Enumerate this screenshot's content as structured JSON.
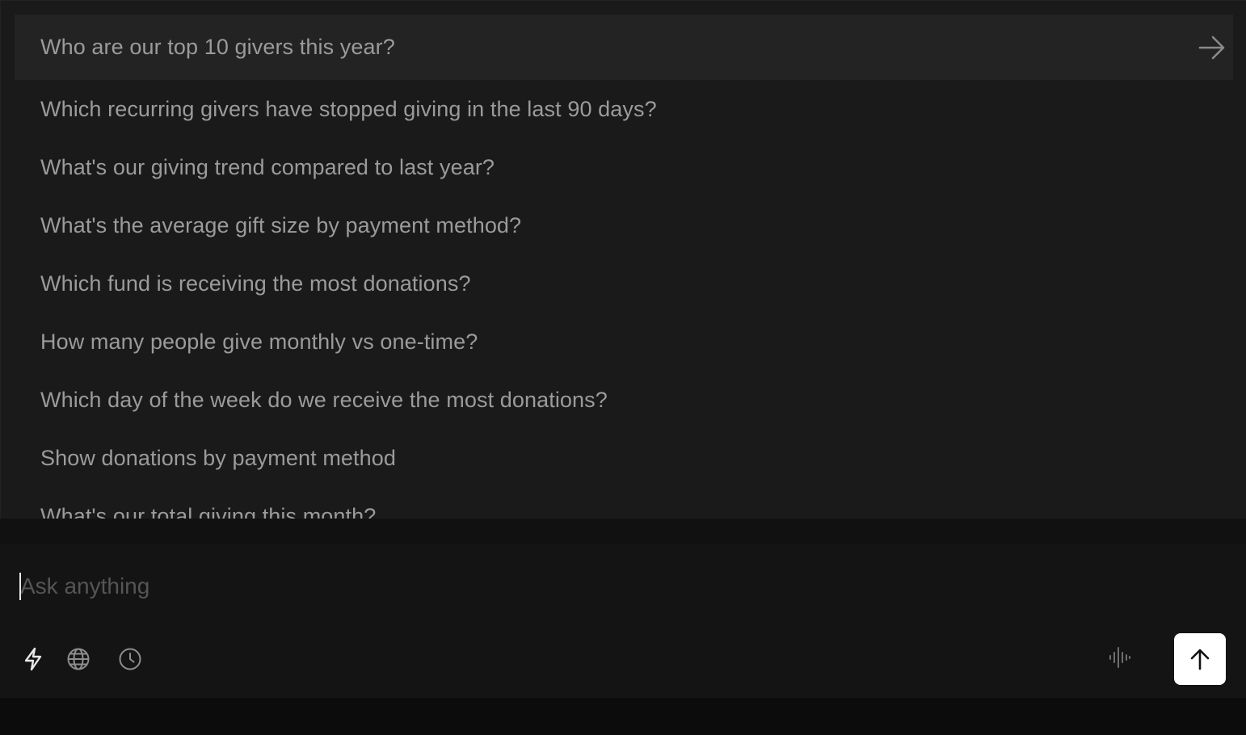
{
  "suggestions": [
    {
      "label": "Who are our top 10 givers this year?",
      "active": true
    },
    {
      "label": "Which recurring givers have stopped giving in the last 90 days?"
    },
    {
      "label": "What's our giving trend compared to last year?"
    },
    {
      "label": "What's the average gift size by payment method?"
    },
    {
      "label": "Which fund is receiving the most donations?"
    },
    {
      "label": "How many people give monthly vs one-time?"
    },
    {
      "label": "Which day of the week do we receive the most donations?"
    },
    {
      "label": "Show donations by payment method"
    },
    {
      "label": "What's our total giving this month?"
    }
  ],
  "composer": {
    "placeholder": "Ask anything",
    "value": "",
    "tools": [
      {
        "icon": "lightning-icon"
      },
      {
        "icon": "globe-icon"
      },
      {
        "icon": "clock-icon"
      }
    ],
    "voice_icon": "waveform-icon",
    "send_icon": "arrow-up-icon"
  },
  "colors": {
    "panel_bg": "#1a1a1a",
    "active_row_bg": "#232323",
    "suggestion_text": "#9b9b9b",
    "composer_bg": "#141414",
    "send_button_bg": "#ffffff"
  }
}
